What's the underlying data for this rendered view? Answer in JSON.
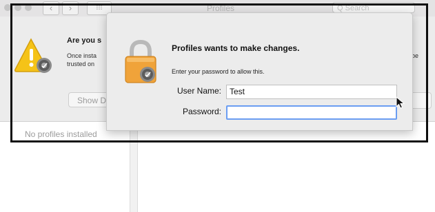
{
  "window": {
    "title": "Profiles",
    "nav_back_glyph": "‹",
    "nav_forward_glyph": "›",
    "grid_glyph": "⁞⁞⁞",
    "search_placeholder": "Q Search"
  },
  "background_sheet": {
    "heading": "Are you s",
    "body_line1": "Once insta",
    "body_line2": "trusted on",
    "body_right_fragment": "be",
    "show_button_label": "Show D",
    "icon": "warning-triangle-with-gear-icon"
  },
  "sidebar": {
    "empty_message": "No profiles installed"
  },
  "auth_dialog": {
    "title": "Profiles wants to make changes.",
    "message": "Enter your password to allow this.",
    "username_label": "User Name:",
    "username_value": "Test",
    "password_label": "Password:",
    "password_value": "",
    "icon": "lock-with-gear-icon"
  },
  "colors": {
    "focus_ring": "#6a9df2",
    "warning_yellow": "#f5c318",
    "lock_orange": "#f0a33a",
    "frame": "#0e0e0e"
  }
}
